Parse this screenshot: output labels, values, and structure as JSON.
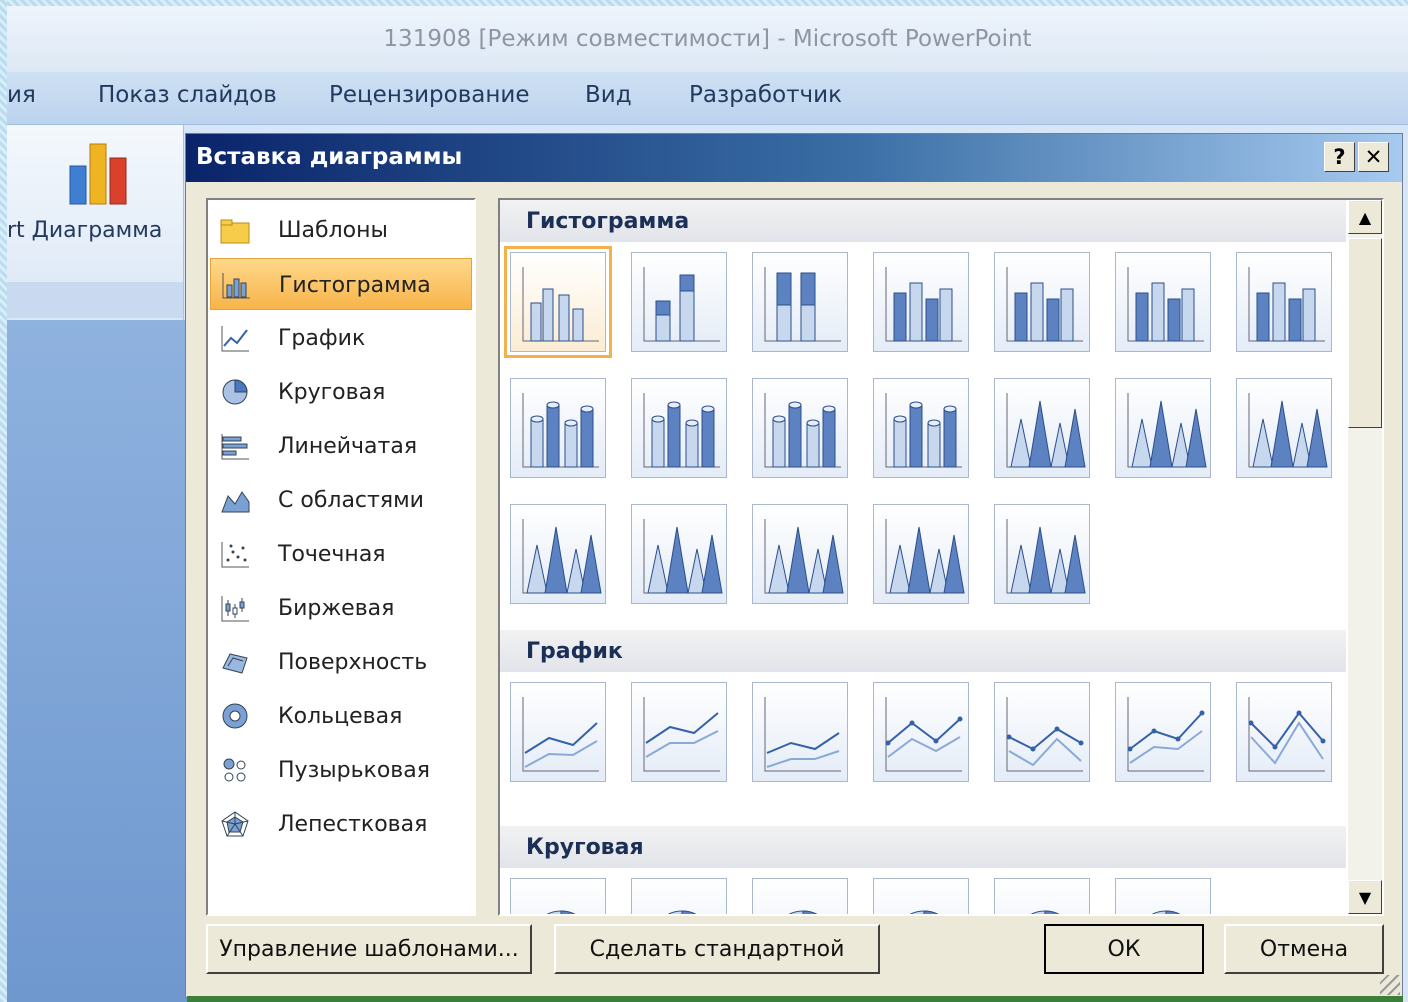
{
  "window": {
    "title": "131908 [Режим совместимости] - Microsoft PowerPoint"
  },
  "ribbon": {
    "tabs": [
      "ия",
      "Показ слайдов",
      "Рецензирование",
      "Вид",
      "Разработчик"
    ],
    "chart_button_label": "rt Диаграмма"
  },
  "dialog": {
    "title": "Вставка диаграммы",
    "help_label": "?",
    "close_label": "✕",
    "categories": [
      {
        "label": "Шаблоны",
        "icon": "folder-icon"
      },
      {
        "label": "Гистограмма",
        "icon": "column-chart-icon",
        "selected": true
      },
      {
        "label": "График",
        "icon": "line-chart-icon"
      },
      {
        "label": "Круговая",
        "icon": "pie-chart-icon"
      },
      {
        "label": "Линейчатая",
        "icon": "bar-chart-icon"
      },
      {
        "label": "С областями",
        "icon": "area-chart-icon"
      },
      {
        "label": "Точечная",
        "icon": "scatter-chart-icon"
      },
      {
        "label": "Биржевая",
        "icon": "stock-chart-icon"
      },
      {
        "label": "Поверхность",
        "icon": "surface-chart-icon"
      },
      {
        "label": "Кольцевая",
        "icon": "doughnut-chart-icon"
      },
      {
        "label": "Пузырьковая",
        "icon": "bubble-chart-icon"
      },
      {
        "label": "Лепестковая",
        "icon": "radar-chart-icon"
      }
    ],
    "gallery_sections": [
      {
        "title": "Гистограмма",
        "count": 19
      },
      {
        "title": "График",
        "count": 7
      },
      {
        "title": "Круговая",
        "count": 6
      }
    ],
    "buttons": {
      "manage_templates": "Управление шаблонами...",
      "set_default": "Сделать стандартной",
      "ok": "ОК",
      "cancel": "Отмена"
    },
    "accent_color": "#f3b04d"
  }
}
